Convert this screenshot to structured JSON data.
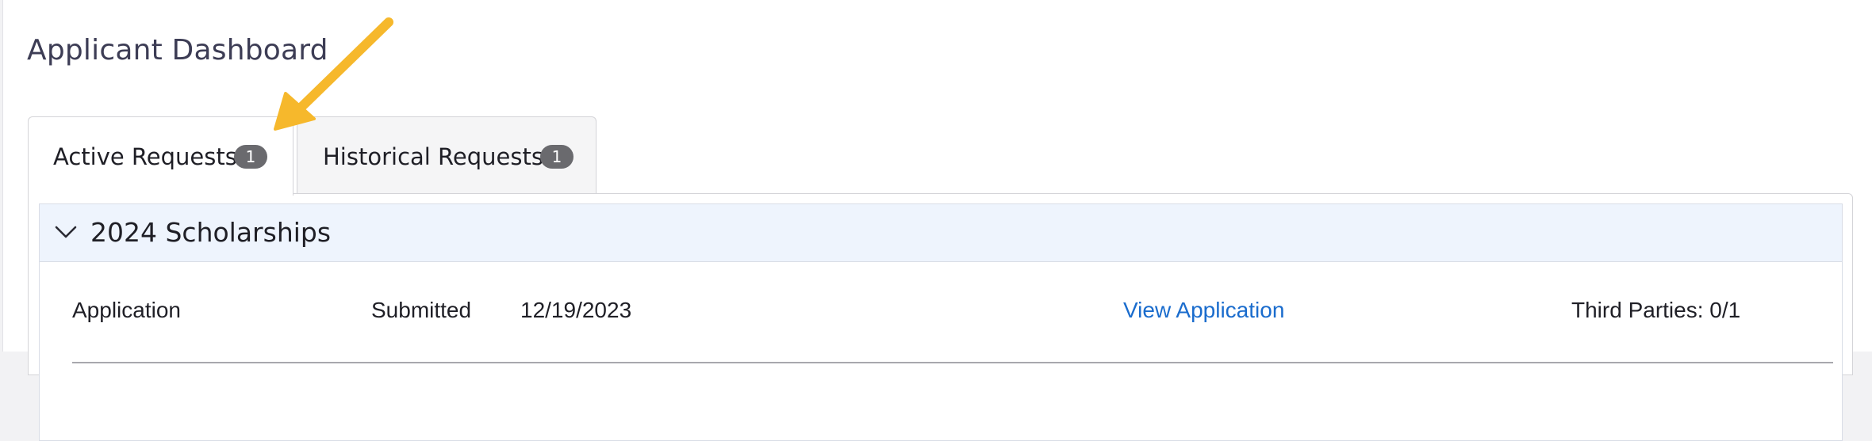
{
  "page": {
    "title": "Applicant Dashboard"
  },
  "tabs": [
    {
      "label": "Active Requests",
      "count": "1",
      "active": true
    },
    {
      "label": "Historical Requests",
      "count": "1",
      "active": false
    }
  ],
  "section": {
    "title": "2024 Scholarships",
    "expanded": true,
    "rows": [
      {
        "type": "Application",
        "status": "Submitted",
        "date": "12/19/2023",
        "link_label": "View Application",
        "third_parties": "Third Parties: 0/1"
      }
    ]
  },
  "annotation": {
    "icon": "pointer-arrow-icon",
    "color": "#f6b82c"
  },
  "colors": {
    "link": "#1a6ccd",
    "section_header_bg": "#eef4fd",
    "badge_bg": "#6a6a6e",
    "title": "#3d3d55"
  }
}
